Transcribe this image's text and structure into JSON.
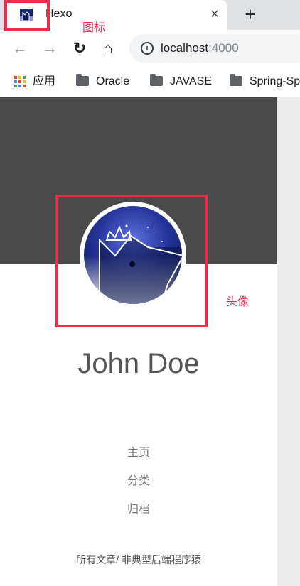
{
  "browser": {
    "tab": {
      "title": "Hexo",
      "favicon": "hexo-avatar-favicon-icon",
      "close_glyph": "×"
    },
    "new_tab_glyph": "+",
    "toolbar": {
      "back_glyph": "←",
      "forward_glyph": "→",
      "reload_glyph": "↻",
      "home_glyph": "⌂",
      "info_glyph": "i",
      "url_host": "localhost",
      "url_port": ":4000"
    },
    "bookmarks": [
      {
        "label": "应用",
        "icon": "apps-grid-icon"
      },
      {
        "label": "Oracle",
        "icon": "folder-icon"
      },
      {
        "label": "JAVASE",
        "icon": "folder-icon"
      },
      {
        "label": "Spring-Sp",
        "icon": "folder-icon"
      }
    ]
  },
  "page": {
    "author": "John Doe",
    "menu": [
      "主页",
      "分类",
      "归档"
    ],
    "footer": "所有文章/ 非典型后端程序猿"
  },
  "annotations": {
    "icon_label": "图标",
    "avatar_label": "头像",
    "color": "#ee2a4e"
  },
  "colors": {
    "header_bg": "#4a4a4a",
    "side_strip": "#ececec"
  }
}
